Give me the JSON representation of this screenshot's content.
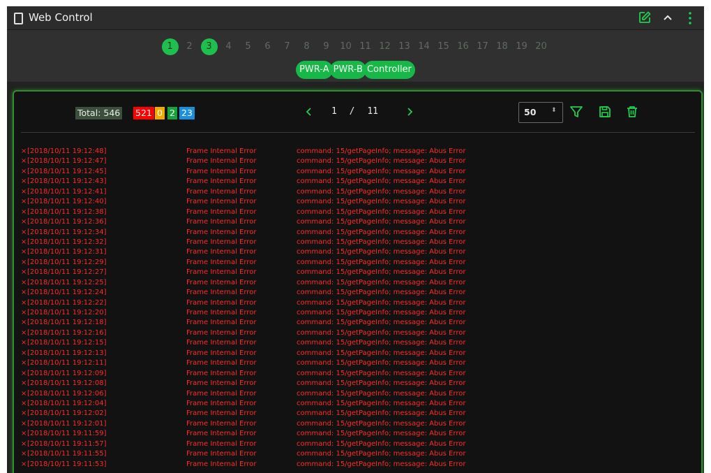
{
  "window": {
    "title": "Web Control"
  },
  "pages": [
    "1",
    "2",
    "3",
    "4",
    "5",
    "6",
    "7",
    "8",
    "9",
    "10",
    "11",
    "12",
    "13",
    "14",
    "15",
    "16",
    "17",
    "18",
    "19",
    "20"
  ],
  "active_pages": [
    "1",
    "3"
  ],
  "modules": [
    "PWR-A",
    "PWR-B",
    "Controller"
  ],
  "stats": {
    "total": "Total: 546",
    "errors": "521",
    "warnings": "0",
    "ok": "2",
    "info": "23"
  },
  "colors": {
    "accent": "#1fbf4f",
    "error": "#ff2a2a",
    "warning": "#f2a900",
    "ok": "#17a33a",
    "info": "#1a8fe0"
  },
  "pager": {
    "current": "1",
    "separator": "/",
    "total": "11"
  },
  "page_size": {
    "value": "50"
  },
  "icons": {
    "title": "window-icon",
    "edit": "edit-icon",
    "collapse": "chevron-up-icon",
    "menu": "more-vertical-icon",
    "prev": "chevron-left-icon",
    "next": "chevron-right-icon",
    "filter": "filter-icon",
    "save": "save-icon",
    "delete": "trash-icon"
  },
  "log": {
    "marker": "×",
    "type": "Frame Internal Error",
    "message": "command: 15/getPageInfo; message: Abus Error",
    "timestamps": [
      "[2018/10/11 19:12:48]",
      "[2018/10/11 19:12:47]",
      "[2018/10/11 19:12:45]",
      "[2018/10/11 19:12:43]",
      "[2018/10/11 19:12:41]",
      "[2018/10/11 19:12:40]",
      "[2018/10/11 19:12:38]",
      "[2018/10/11 19:12:36]",
      "[2018/10/11 19:12:34]",
      "[2018/10/11 19:12:32]",
      "[2018/10/11 19:12:31]",
      "[2018/10/11 19:12:29]",
      "[2018/10/11 19:12:27]",
      "[2018/10/11 19:12:25]",
      "[2018/10/11 19:12:24]",
      "[2018/10/11 19:12:22]",
      "[2018/10/11 19:12:20]",
      "[2018/10/11 19:12:18]",
      "[2018/10/11 19:12:16]",
      "[2018/10/11 19:12:15]",
      "[2018/10/11 19:12:13]",
      "[2018/10/11 19:12:11]",
      "[2018/10/11 19:12:09]",
      "[2018/10/11 19:12:08]",
      "[2018/10/11 19:12:06]",
      "[2018/10/11 19:12:04]",
      "[2018/10/11 19:12:02]",
      "[2018/10/11 19:12:01]",
      "[2018/10/11 19:11:59]",
      "[2018/10/11 19:11:57]",
      "[2018/10/11 19:11:55]",
      "[2018/10/11 19:11:53]"
    ]
  }
}
